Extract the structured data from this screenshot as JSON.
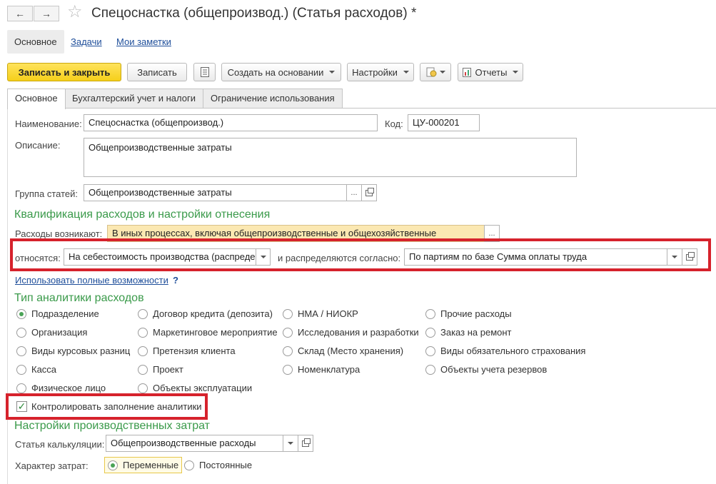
{
  "window": {
    "title": "Спецоснастка (общепроизвод.) (Статья расходов) *",
    "back_icon": "←",
    "forward_icon": "→",
    "star_icon": "☆"
  },
  "section_tabs": [
    {
      "label": "Основное"
    },
    {
      "label": "Задачи"
    },
    {
      "label": "Мои заметки"
    }
  ],
  "toolbar": {
    "save_close": "Записать и закрыть",
    "save": "Записать",
    "create_based": "Создать на основании",
    "settings": "Настройки",
    "reports": "Отчеты"
  },
  "form_tabs": [
    {
      "label": "Основное"
    },
    {
      "label": "Бухгалтерский учет и налоги"
    },
    {
      "label": "Ограничение использования"
    }
  ],
  "form": {
    "name_label": "Наименование:",
    "name_value": "Спецоснастка (общепроизвод.)",
    "code_label": "Код:",
    "code_value": "ЦУ-000201",
    "desc_label": "Описание:",
    "desc_value": "Общепроизводственные затраты",
    "group_label": "Группа статей:",
    "group_value": "Общепроизводственные затраты",
    "choose_btn": "..."
  },
  "qualification": {
    "title": "Квалификация расходов и настройки отнесения",
    "arise_label": "Расходы возникают:",
    "arise_value": "В иных процессах, включая общепроизводственные и общехозяйственные",
    "relate_label": "относятся:",
    "relate_value": "На себестоимость производства (распреде",
    "distribute_label": "и распределяются согласно:",
    "distribute_value": "По партиям по базе Сумма оплаты труда",
    "full_link": "Использовать полные возможности",
    "help": "?"
  },
  "analytics": {
    "title": "Тип аналитики расходов",
    "options": [
      {
        "label": "Подразделение",
        "selected": true
      },
      {
        "label": "Договор кредита (депозита)",
        "selected": false
      },
      {
        "label": "НМА / НИОКР",
        "selected": false
      },
      {
        "label": "Прочие расходы",
        "selected": false
      },
      {
        "label": "Организация",
        "selected": false
      },
      {
        "label": "Маркетинговое мероприятие",
        "selected": false
      },
      {
        "label": "Исследования и разработки",
        "selected": false
      },
      {
        "label": "Заказ на ремонт",
        "selected": false
      },
      {
        "label": "Виды курсовых разниц",
        "selected": false
      },
      {
        "label": "Претензия клиента",
        "selected": false
      },
      {
        "label": "Склад (Место хранения)",
        "selected": false
      },
      {
        "label": "Виды обязательного страхования",
        "selected": false
      },
      {
        "label": "Касса",
        "selected": false
      },
      {
        "label": "Проект",
        "selected": false
      },
      {
        "label": "Номенклатура",
        "selected": false
      },
      {
        "label": "Объекты учета резервов",
        "selected": false
      },
      {
        "label": "Физическое лицо",
        "selected": false
      },
      {
        "label": "Объекты эксплуатации",
        "selected": false
      }
    ],
    "control_label": "Контролировать заполнение аналитики",
    "control_checked": true,
    "check_mark": "✓"
  },
  "production": {
    "title": "Настройки производственных затрат",
    "calc_label": "Статья калькуляции:",
    "calc_value": "Общепроизводственные расходы",
    "nature_label": "Характер затрат:",
    "variable": "Переменные",
    "constant": "Постоянные"
  },
  "colors": {
    "accent_green": "#3a9a4a",
    "primary_button": "#f5cf1a",
    "highlight_red": "#d6222c",
    "link_blue": "#1e4e9a"
  }
}
